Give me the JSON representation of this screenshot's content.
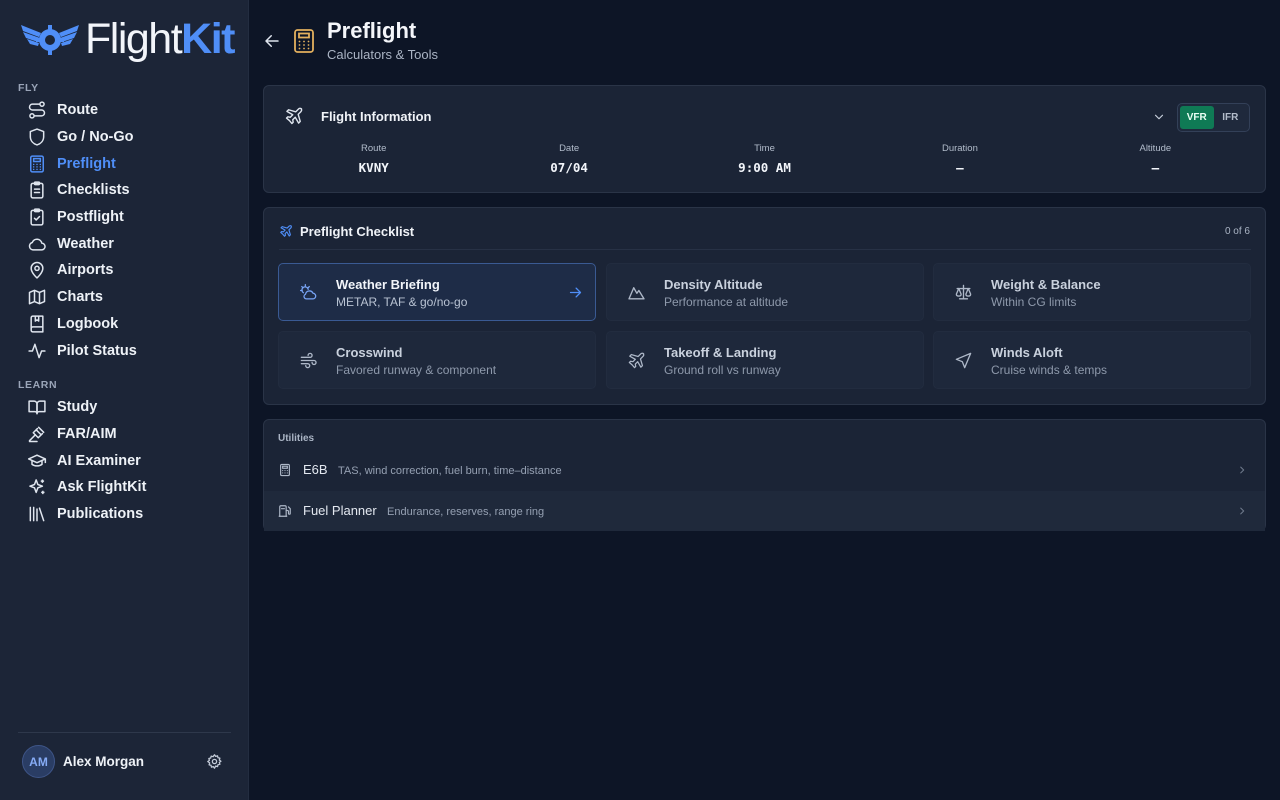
{
  "app": {
    "logo_part1": "Flight",
    "logo_part2": "Kit",
    "brand_color": "#4f8ef7"
  },
  "sidebar": {
    "sections": [
      {
        "label": "FLY",
        "items": [
          {
            "label": "Route",
            "icon": "route-icon"
          },
          {
            "label": "Go / No-Go",
            "icon": "shield-icon"
          },
          {
            "label": "Preflight",
            "icon": "calculator-icon",
            "active": true
          },
          {
            "label": "Checklists",
            "icon": "clipboard-list-icon"
          },
          {
            "label": "Postflight",
            "icon": "clipboard-check-icon"
          },
          {
            "label": "Weather",
            "icon": "cloud-icon"
          },
          {
            "label": "Airports",
            "icon": "map-pin-icon"
          },
          {
            "label": "Charts",
            "icon": "map-icon"
          },
          {
            "label": "Logbook",
            "icon": "book-icon"
          },
          {
            "label": "Pilot Status",
            "icon": "activity-icon"
          }
        ]
      },
      {
        "label": "LEARN",
        "items": [
          {
            "label": "Study",
            "icon": "book-open-icon"
          },
          {
            "label": "FAR/AIM",
            "icon": "gavel-icon"
          },
          {
            "label": "AI Examiner",
            "icon": "graduation-cap-icon"
          },
          {
            "label": "Ask FlightKit",
            "icon": "sparkles-icon"
          },
          {
            "label": "Publications",
            "icon": "library-icon"
          }
        ]
      }
    ],
    "user": {
      "initials": "AM",
      "name": "Alex Morgan"
    }
  },
  "header": {
    "title": "Preflight",
    "subtitle": "Calculators & Tools"
  },
  "flight_info": {
    "title": "Flight Information",
    "mode_options": [
      "VFR",
      "IFR"
    ],
    "selected_mode": "VFR",
    "fields": [
      {
        "label": "Route",
        "value": "KVNY"
      },
      {
        "label": "Date",
        "value": "07/04"
      },
      {
        "label": "Time",
        "value": "9:00 AM"
      },
      {
        "label": "Duration",
        "value": "—"
      },
      {
        "label": "Altitude",
        "value": "—"
      }
    ]
  },
  "checklist": {
    "title": "Preflight Checklist",
    "progress": "0 of 6",
    "completed": 0,
    "total": 6,
    "tiles": [
      {
        "title": "Weather Briefing",
        "subtitle": "METAR, TAF & go/no-go",
        "icon": "cloud-sun-icon",
        "highlight": true
      },
      {
        "title": "Density Altitude",
        "subtitle": "Performance at altitude",
        "icon": "mountain-icon"
      },
      {
        "title": "Weight & Balance",
        "subtitle": "Within CG limits",
        "icon": "scale-icon"
      },
      {
        "title": "Crosswind",
        "subtitle": "Favored runway & component",
        "icon": "wind-icon"
      },
      {
        "title": "Takeoff & Landing",
        "subtitle": "Ground roll vs runway",
        "icon": "plane-icon"
      },
      {
        "title": "Winds Aloft",
        "subtitle": "Cruise winds & temps",
        "icon": "navigation-icon"
      }
    ]
  },
  "utilities": {
    "label": "Utilities",
    "items": [
      {
        "title": "E6B",
        "description": "TAS, wind correction, fuel burn, time–distance",
        "icon": "calculator-icon"
      },
      {
        "title": "Fuel Planner",
        "description": "Endurance, reserves, range ring",
        "icon": "fuel-icon"
      }
    ]
  }
}
